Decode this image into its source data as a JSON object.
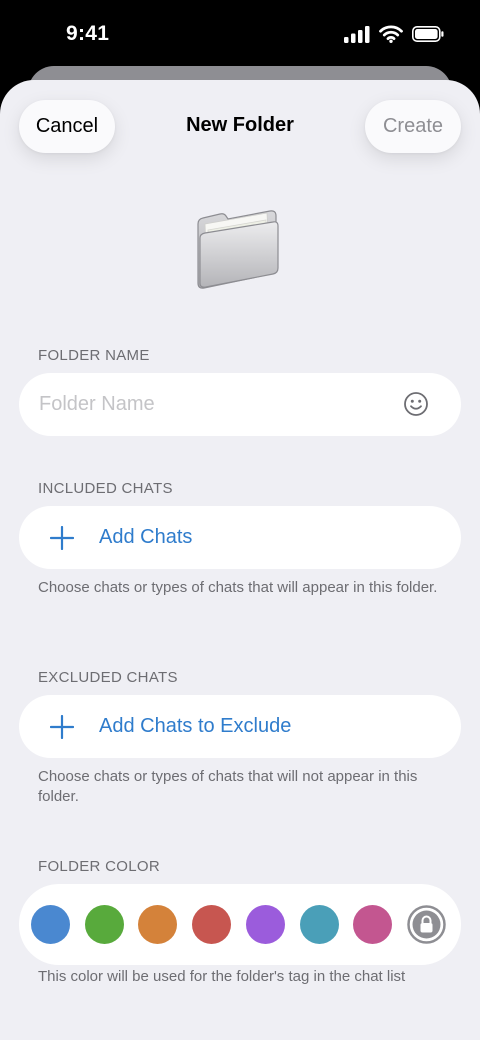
{
  "status_bar": {
    "time": "9:41",
    "icons": [
      "cellular-signal-icon",
      "wifi-icon",
      "battery-icon"
    ]
  },
  "header": {
    "cancel_label": "Cancel",
    "title": "New Folder",
    "create_label": "Create"
  },
  "folder_name": {
    "section_label": "FOLDER NAME",
    "placeholder": "Folder Name",
    "value": ""
  },
  "included_chats": {
    "section_label": "INCLUDED CHATS",
    "add_label": "Add Chats",
    "footer": "Choose chats or types of chats that will appear in this folder."
  },
  "excluded_chats": {
    "section_label": "EXCLUDED CHATS",
    "add_label": "Add Chats to Exclude",
    "footer": "Choose chats or types of chats that will not appear in this folder."
  },
  "folder_color": {
    "section_label": "FOLDER COLOR",
    "colors": [
      "#4a88d0",
      "#58aa3c",
      "#d4823a",
      "#c75650",
      "#9b5cdc",
      "#4a9fb8",
      "#c35690"
    ],
    "locked_option_color": "#8e8e93",
    "footer": "This color will be used for the folder's tag in the chat list"
  },
  "accent_color": "#2f7ccc"
}
